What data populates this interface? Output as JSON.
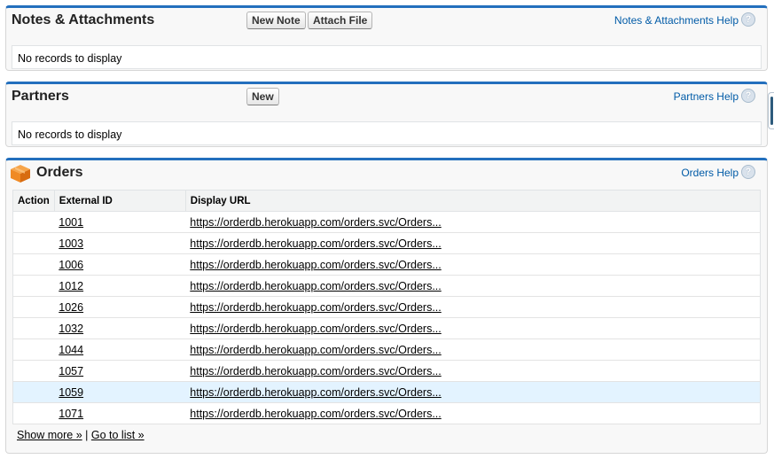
{
  "notes": {
    "title": "Notes & Attachments",
    "new_note_label": "New Note",
    "attach_file_label": "Attach File",
    "help_label": "Notes & Attachments Help",
    "help_icon": "?",
    "empty_text": "No records to display"
  },
  "partners": {
    "title": "Partners",
    "new_label": "New",
    "help_label": "Partners Help",
    "help_icon": "?",
    "empty_text": "No records to display"
  },
  "orders": {
    "title": "Orders",
    "icon": "orders-box-icon",
    "help_label": "Orders Help",
    "help_icon": "?",
    "columns": [
      "Action",
      "External ID",
      "Display URL"
    ],
    "rows": [
      {
        "id": "1001",
        "url": "https://orderdb.herokuapp.com/orders.svc/Orders..."
      },
      {
        "id": "1003",
        "url": "https://orderdb.herokuapp.com/orders.svc/Orders..."
      },
      {
        "id": "1006",
        "url": "https://orderdb.herokuapp.com/orders.svc/Orders..."
      },
      {
        "id": "1012",
        "url": "https://orderdb.herokuapp.com/orders.svc/Orders..."
      },
      {
        "id": "1026",
        "url": "https://orderdb.herokuapp.com/orders.svc/Orders..."
      },
      {
        "id": "1032",
        "url": "https://orderdb.herokuapp.com/orders.svc/Orders..."
      },
      {
        "id": "1044",
        "url": "https://orderdb.herokuapp.com/orders.svc/Orders..."
      },
      {
        "id": "1057",
        "url": "https://orderdb.herokuapp.com/orders.svc/Orders..."
      },
      {
        "id": "1059",
        "url": "https://orderdb.herokuapp.com/orders.svc/Orders...",
        "highlighted": true
      },
      {
        "id": "1071",
        "url": "https://orderdb.herokuapp.com/orders.svc/Orders..."
      }
    ],
    "show_more_label": "Show more »",
    "separator": "|",
    "go_to_list_label": "Go to list »"
  },
  "colors": {
    "panel_accent": "#236fbd",
    "link": "#015ba7",
    "highlight_row": "#e3f3ff",
    "orders_icon": "#f08a24"
  }
}
